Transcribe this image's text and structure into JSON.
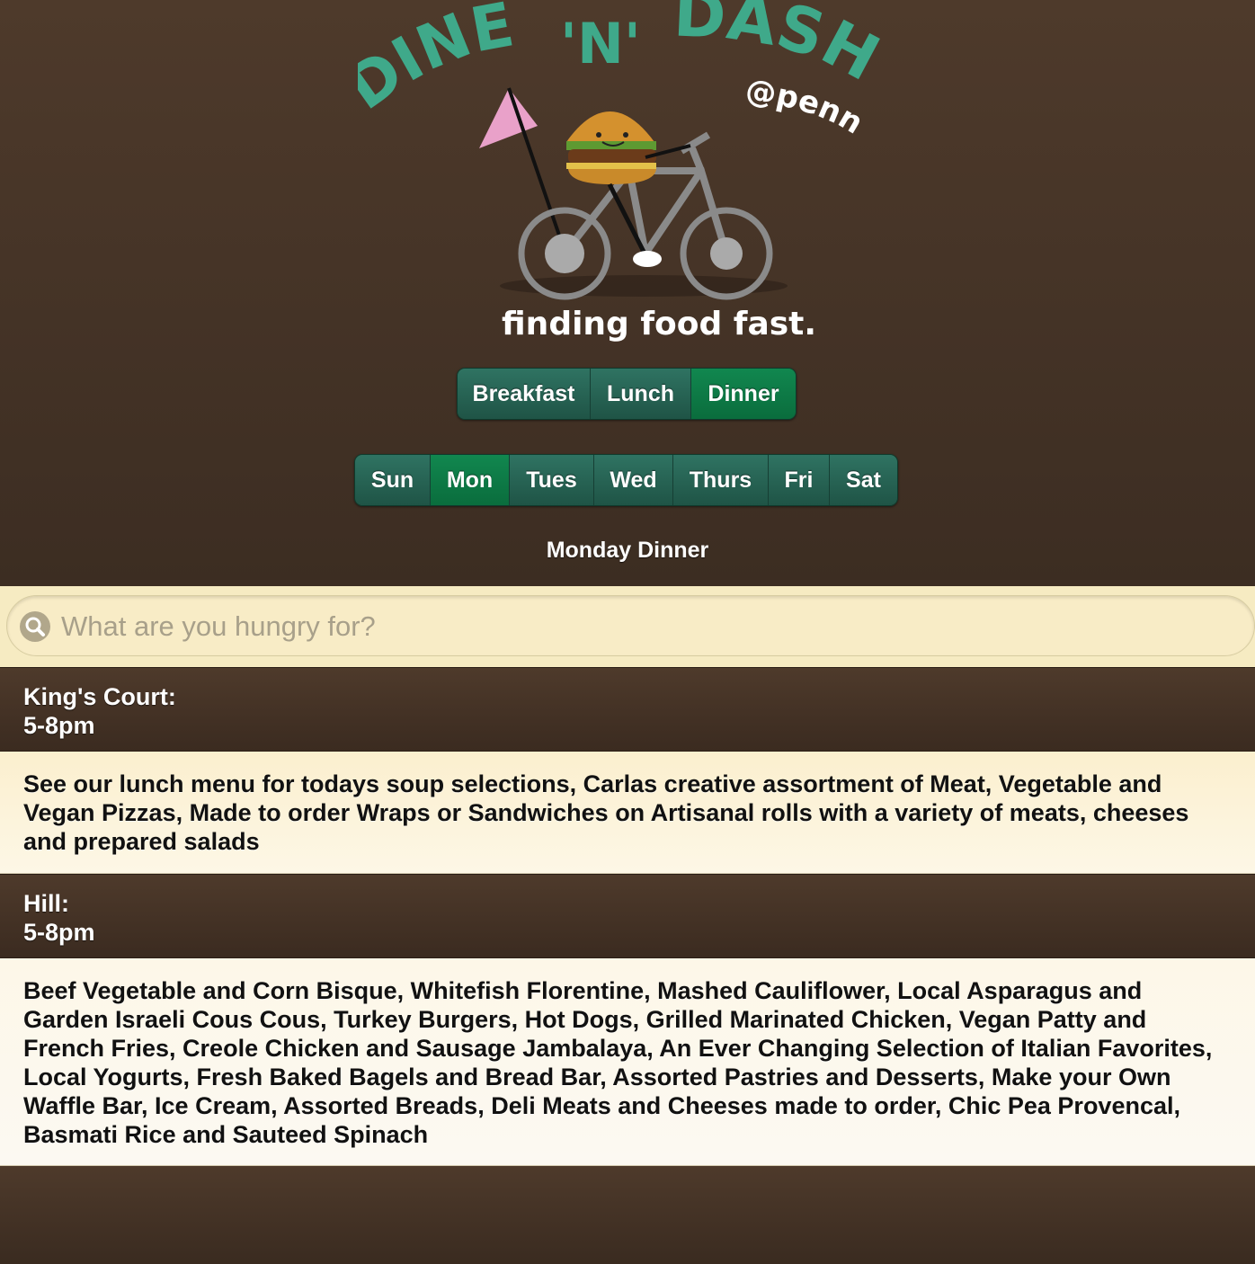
{
  "logo": {
    "title_left": "DINE",
    "title_middle": "'N'",
    "title_right": "DASH",
    "subtitle": "@penn",
    "tagline": "finding food fast."
  },
  "meals": {
    "items": [
      "Breakfast",
      "Lunch",
      "Dinner"
    ],
    "selected": "Dinner"
  },
  "days": {
    "items": [
      "Sun",
      "Mon",
      "Tues",
      "Wed",
      "Thurs",
      "Fri",
      "Sat"
    ],
    "selected": "Mon"
  },
  "page_heading": "Monday Dinner",
  "search": {
    "placeholder": "What are you hungry for?",
    "value": ""
  },
  "halls": [
    {
      "name": "King's Court:",
      "hours": "5-8pm",
      "menu": "See our lunch menu for todays soup selections, Carlas creative assortment of Meat, Vegetable and Vegan Pizzas, Made to order Wraps or Sandwiches on Artisanal rolls with a variety of meats, cheeses and prepared salads"
    },
    {
      "name": "Hill:",
      "hours": "5-8pm",
      "menu": "Beef Vegetable and Corn Bisque, Whitefish Florentine, Mashed Cauliflower, Local Asparagus and Garden Israeli Cous Cous, Turkey Burgers, Hot Dogs, Grilled Marinated Chicken, Vegan Patty and French Fries, Creole Chicken and Sausage Jambalaya, An Ever Changing Selection of Italian Favorites, Local Yogurts, Fresh Baked Bagels and Bread Bar, Assorted Pastries and Desserts, Make your Own Waffle Bar, Ice Cream, Assorted Breads, Deli Meats and Cheeses made to order, Chic Pea Provencal, Basmati Rice and Sauteed Spinach"
    }
  ],
  "colors": {
    "brand_green": "#3fa98a",
    "active_segment": "#0d7a46",
    "segment": "#26604f",
    "background_brown": "#4a3729",
    "menu_cream": "#fbf1d3"
  }
}
